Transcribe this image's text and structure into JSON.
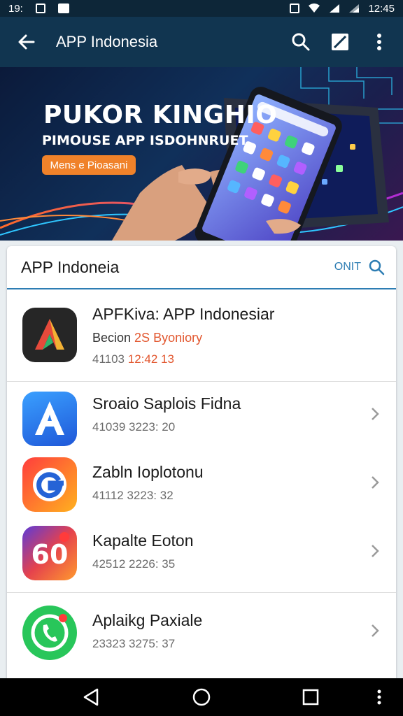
{
  "status_bar": {
    "time_left": "19:",
    "time_right": "12:45"
  },
  "app_bar": {
    "title": "APP Indonesia"
  },
  "banner": {
    "headline": "PUKOR KINGHIO",
    "subheadline": "PIMOUSE APP ISDOHNRUET",
    "cta_label": "Mens e Pioasani"
  },
  "card": {
    "title": "APP Indoneia",
    "header_action": "ONIT",
    "featured": {
      "name": "APFKiva: APP Indonesiar",
      "subtitle_plain": "Becion ",
      "subtitle_highlight": "2S Byoniory",
      "meta_plain": "41103 ",
      "meta_highlight": "12:42 13"
    },
    "items": [
      {
        "name": "Sroaio Saplois Fidna",
        "meta": "41039 3223: 20",
        "icon": "letter-a-app-icon"
      },
      {
        "name": "Zabln Ioplotonu",
        "meta": "41112 3223: 32",
        "icon": "letter-g-app-icon"
      },
      {
        "name": "Kapalte Eoton",
        "meta": "42512 2226: 35",
        "icon": "sixty-app-icon"
      },
      {
        "name": "Aplaikg Paxiale",
        "meta": "23323 3275: 37",
        "icon": "phone-chat-app-icon"
      }
    ]
  },
  "colors": {
    "app_bar": "#113550",
    "accent": "#2d7db3",
    "cta": "#f0822a",
    "highlight": "#e2572f"
  }
}
